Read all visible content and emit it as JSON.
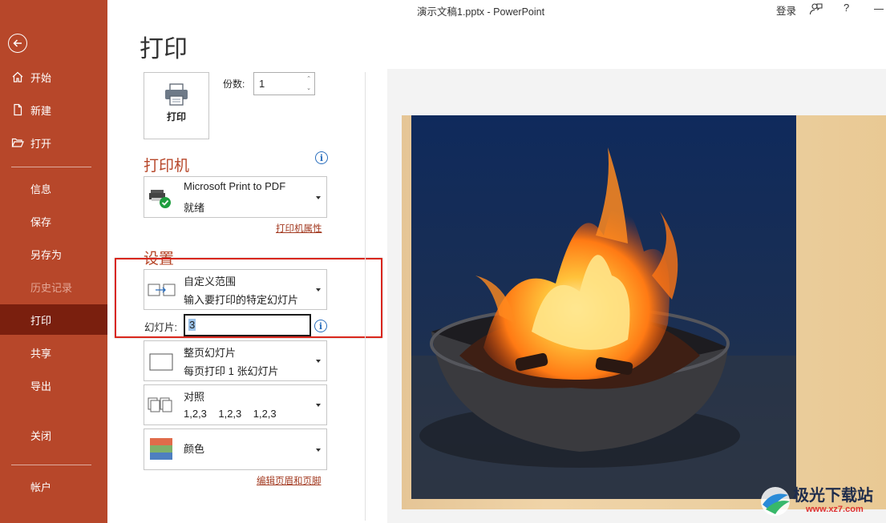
{
  "titlebar": {
    "title": "演示文稿1.pptx  -  PowerPoint",
    "login": "登录",
    "help": "?"
  },
  "sidebar": {
    "items": [
      {
        "label": "开始"
      },
      {
        "label": "新建"
      },
      {
        "label": "打开"
      },
      {
        "label": "信息"
      },
      {
        "label": "保存"
      },
      {
        "label": "另存为"
      },
      {
        "label": "历史记录"
      },
      {
        "label": "打印"
      },
      {
        "label": "共享"
      },
      {
        "label": "导出"
      },
      {
        "label": "关闭"
      },
      {
        "label": "帐户"
      }
    ]
  },
  "main": {
    "title": "打印",
    "print_button_label": "打印",
    "copies_label": "份数:",
    "copies_value": "1",
    "printer_heading": "打印机",
    "printer_name": "Microsoft Print to PDF",
    "printer_status": "就绪",
    "printer_properties_link": "打印机属性",
    "settings_heading": "设置",
    "range_title": "自定义范围",
    "range_desc": "输入要打印的特定幻灯片",
    "slides_label": "幻灯片:",
    "slides_value": "3",
    "layout_title": "整页幻灯片",
    "layout_desc": "每页打印 1 张幻灯片",
    "collate_title": "对照",
    "collate_desc": "1,2,3    1,2,3    1,2,3",
    "color_title": "颜色",
    "edit_header_footer_link": "编辑页眉和页脚"
  },
  "watermark": {
    "title": "极光下载站",
    "url": "www.xz7.com"
  },
  "colors": {
    "sidebar_bg": "#b7472a",
    "sidebar_active": "#7a1f0e",
    "accent": "#b7472a",
    "highlight_box": "#d9261c"
  }
}
